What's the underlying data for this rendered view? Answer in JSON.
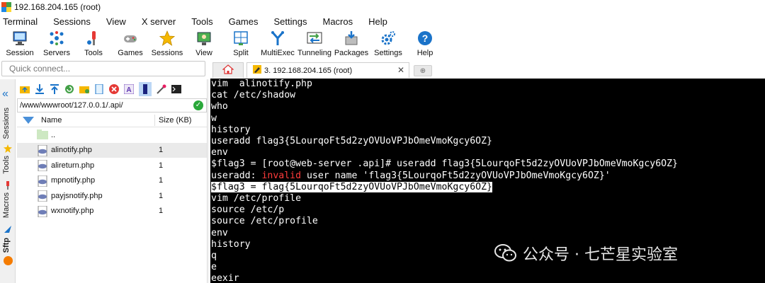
{
  "window": {
    "title": "192.168.204.165 (root)"
  },
  "menu": [
    "Terminal",
    "Sessions",
    "View",
    "X server",
    "Tools",
    "Games",
    "Settings",
    "Macros",
    "Help"
  ],
  "toolbar": [
    {
      "label": "Session",
      "icon": "session-icon"
    },
    {
      "label": "Servers",
      "icon": "servers-icon"
    },
    {
      "label": "Tools",
      "icon": "tools-icon"
    },
    {
      "label": "Games",
      "icon": "games-icon"
    },
    {
      "label": "Sessions",
      "icon": "sessions-star-icon"
    },
    {
      "label": "View",
      "icon": "view-icon"
    },
    {
      "label": "Split",
      "icon": "split-icon"
    },
    {
      "label": "MultiExec",
      "icon": "multiexec-icon"
    },
    {
      "label": "Tunneling",
      "icon": "tunneling-icon"
    },
    {
      "label": "Packages",
      "icon": "packages-icon"
    },
    {
      "label": "Settings",
      "icon": "settings-icon"
    },
    {
      "label": "Help",
      "icon": "help-icon"
    }
  ],
  "quick_connect": {
    "placeholder": "Quick connect..."
  },
  "tabs": {
    "active_label": "3. 192.168.204.165 (root)",
    "close": "✕",
    "new": "⊕"
  },
  "left_strip": {
    "sessions": "Sessions",
    "tools": "Tools",
    "macros": "Macros",
    "sftp": "Sftp"
  },
  "sftp": {
    "path": "/www/wwwroot/127.0.0.1/.api/",
    "columns": {
      "name": "Name",
      "size": "Size (KB)"
    },
    "files": [
      {
        "name": "..",
        "size": "",
        "type": "parent-folder"
      },
      {
        "name": "alinotify.php",
        "size": "1",
        "type": "php"
      },
      {
        "name": "alireturn.php",
        "size": "1",
        "type": "php"
      },
      {
        "name": "mpnotify.php",
        "size": "1",
        "type": "php"
      },
      {
        "name": "payjsnotify.php",
        "size": "1",
        "type": "php"
      },
      {
        "name": "wxnotify.php",
        "size": "1",
        "type": "php"
      }
    ]
  },
  "terminal": {
    "lines": [
      {
        "text": "vim  alinotify.php"
      },
      {
        "text": "cat /etc/shadow"
      },
      {
        "text": "who"
      },
      {
        "text": "w"
      },
      {
        "text": "history"
      },
      {
        "text": "useradd flag3{5LourqoFt5d2zyOVUoVPJbOmeVmoKgcy6OZ}"
      },
      {
        "text": "env"
      },
      {
        "text": "$flag3 = [root@web-server .api]# useradd flag3{5LourqoFt5d2zyOVUoVPJbOmeVmoKgcy6OZ}"
      },
      {
        "pre": "useradd: ",
        "red": "invalid",
        "post": " user name 'flag3{5LourqoFt5d2zyOVUoVPJbOmeVmoKgcy6OZ}'"
      },
      {
        "text": "$flag3 = flag{5LourqoFt5d2zyOVUoVPJbOmeVmoKgcy6OZ}",
        "highlight": true
      },
      {
        "text": "vim /etc/profile"
      },
      {
        "text": "source /etc/p"
      },
      {
        "text": "source /etc/profile"
      },
      {
        "text": "env"
      },
      {
        "text": "history"
      },
      {
        "text": "q"
      },
      {
        "text": "e"
      },
      {
        "text": "eexir"
      }
    ]
  },
  "watermark": {
    "text": "公众号 · 七芒星实验室"
  },
  "colors": {
    "terminal_bg": "#000000",
    "terminal_fg": "#ffffff",
    "error_red": "#ff3b3b",
    "accent_blue": "#1a73c9"
  }
}
